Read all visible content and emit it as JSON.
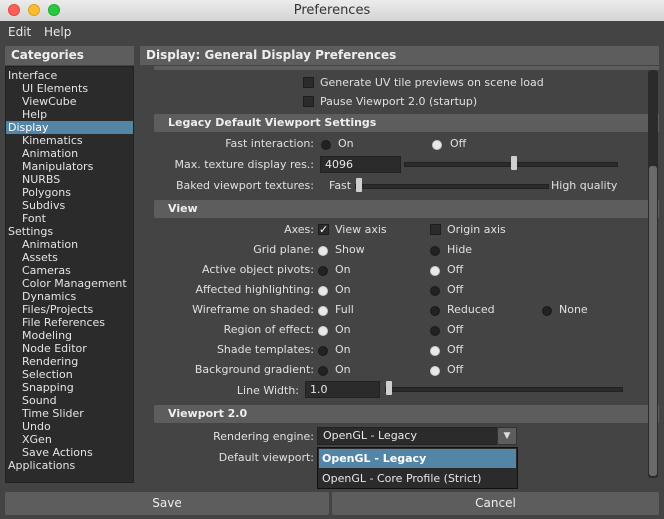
{
  "window": {
    "title": "Preferences"
  },
  "menu": {
    "items": [
      "Edit",
      "Help"
    ]
  },
  "categories": {
    "header": "Categories",
    "items": [
      {
        "label": "Interface",
        "indent": 0,
        "selected": false
      },
      {
        "label": "UI Elements",
        "indent": 1,
        "selected": false
      },
      {
        "label": "ViewCube",
        "indent": 1,
        "selected": false
      },
      {
        "label": "Help",
        "indent": 1,
        "selected": false
      },
      {
        "label": "Display",
        "indent": 0,
        "selected": true
      },
      {
        "label": "Kinematics",
        "indent": 1,
        "selected": false
      },
      {
        "label": "Animation",
        "indent": 1,
        "selected": false
      },
      {
        "label": "Manipulators",
        "indent": 1,
        "selected": false
      },
      {
        "label": "NURBS",
        "indent": 1,
        "selected": false
      },
      {
        "label": "Polygons",
        "indent": 1,
        "selected": false
      },
      {
        "label": "Subdivs",
        "indent": 1,
        "selected": false
      },
      {
        "label": "Font",
        "indent": 1,
        "selected": false
      },
      {
        "label": "Settings",
        "indent": 0,
        "selected": false
      },
      {
        "label": "Animation",
        "indent": 1,
        "selected": false
      },
      {
        "label": "Assets",
        "indent": 1,
        "selected": false
      },
      {
        "label": "Cameras",
        "indent": 1,
        "selected": false
      },
      {
        "label": "Color Management",
        "indent": 1,
        "selected": false
      },
      {
        "label": "Dynamics",
        "indent": 1,
        "selected": false
      },
      {
        "label": "Files/Projects",
        "indent": 1,
        "selected": false
      },
      {
        "label": "File References",
        "indent": 1,
        "selected": false
      },
      {
        "label": "Modeling",
        "indent": 1,
        "selected": false
      },
      {
        "label": "Node Editor",
        "indent": 1,
        "selected": false
      },
      {
        "label": "Rendering",
        "indent": 1,
        "selected": false
      },
      {
        "label": "Selection",
        "indent": 1,
        "selected": false
      },
      {
        "label": "Snapping",
        "indent": 1,
        "selected": false
      },
      {
        "label": "Sound",
        "indent": 1,
        "selected": false
      },
      {
        "label": "Time Slider",
        "indent": 1,
        "selected": false
      },
      {
        "label": "Undo",
        "indent": 1,
        "selected": false
      },
      {
        "label": "XGen",
        "indent": 1,
        "selected": false
      },
      {
        "label": "Save Actions",
        "indent": 1,
        "selected": false
      },
      {
        "label": "Applications",
        "indent": 0,
        "selected": false
      }
    ]
  },
  "panel": {
    "header": "Display: General Display Preferences",
    "top_checks": {
      "uv_tile": {
        "label": "Generate UV tile previews on scene load",
        "checked": false
      },
      "pause_vp2": {
        "label": "Pause Viewport 2.0 (startup)",
        "checked": false
      }
    },
    "legacy": {
      "title": "Legacy Default Viewport Settings",
      "fast_interaction": {
        "label": "Fast interaction:",
        "on": "On",
        "off": "Off",
        "value": "Off"
      },
      "max_texture": {
        "label": "Max. texture display res.:",
        "value": "4096",
        "slider_fraction": 0.52
      },
      "baked": {
        "label": "Baked viewport textures:",
        "low": "Fast",
        "high": "High quality",
        "slider_fraction": 0.0
      }
    },
    "view": {
      "title": "View",
      "axes": {
        "label": "Axes:",
        "view_axis": "View axis",
        "view_axis_checked": true,
        "origin_axis": "Origin axis",
        "origin_axis_checked": false
      },
      "grid_plane": {
        "label": "Grid plane:",
        "a": "Show",
        "b": "Hide",
        "value": "Show"
      },
      "active_pivots": {
        "label": "Active object pivots:",
        "a": "On",
        "b": "Off",
        "value": "Off"
      },
      "affected_highlighting": {
        "label": "Affected highlighting:",
        "a": "On",
        "b": "Off",
        "value": "On"
      },
      "wireframe_shaded": {
        "label": "Wireframe on shaded:",
        "a": "Full",
        "b": "Reduced",
        "c": "None",
        "value": "Full"
      },
      "region_of_effect": {
        "label": "Region of effect:",
        "a": "On",
        "b": "Off",
        "value": "On"
      },
      "shade_templates": {
        "label": "Shade templates:",
        "a": "On",
        "b": "Off",
        "value": "Off"
      },
      "background_gradient": {
        "label": "Background gradient:",
        "a": "On",
        "b": "Off",
        "value": "Off"
      },
      "line_width": {
        "label": "Line Width:",
        "value": "1.0",
        "slider_fraction": 0.0
      }
    },
    "viewport2": {
      "title": "Viewport 2.0",
      "rendering_engine": {
        "label": "Rendering engine:",
        "value": "OpenGL - Legacy"
      },
      "default_viewport": {
        "label": "Default viewport:"
      },
      "dropdown_options": [
        "OpenGL - Legacy",
        "OpenGL - Core Profile (Strict)"
      ],
      "dropdown_selected": "OpenGL - Legacy"
    }
  },
  "buttons": {
    "save": "Save",
    "cancel": "Cancel"
  },
  "colors": {
    "background": "#444444",
    "header": "#5d5d5d",
    "field": "#2b2b2b",
    "selection": "#5285a6"
  }
}
